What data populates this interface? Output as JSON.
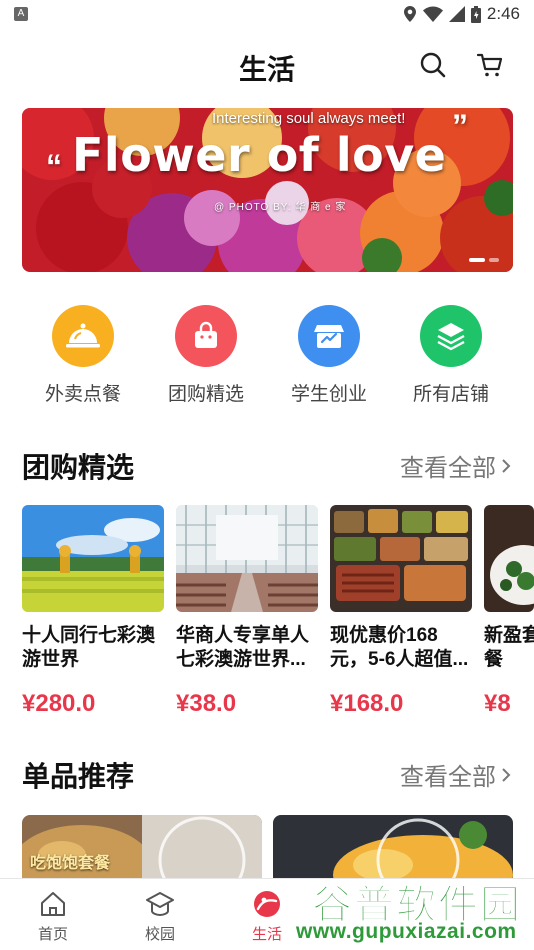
{
  "status_bar": {
    "time": "2:46",
    "notification_icon": "A"
  },
  "header": {
    "title": "生活",
    "search_icon": "search-icon",
    "cart_icon": "cart-icon"
  },
  "banner": {
    "headline": "Flower of love",
    "subtitle": "Interesting soul always meet!",
    "photo_credit": "@ PHOTO BY: 华 商 e 家",
    "quote_open": "“",
    "quote_close": "”",
    "page_count": 2,
    "active_page": 1
  },
  "categories": [
    {
      "label": "外卖点餐",
      "icon": "food-cloche-icon",
      "color": "#f9b020"
    },
    {
      "label": "团购精选",
      "icon": "shopping-bag-icon",
      "color": "#f4545b"
    },
    {
      "label": "学生创业",
      "icon": "storefront-icon",
      "color": "#3f8ff0"
    },
    {
      "label": "所有店铺",
      "icon": "layers-icon",
      "color": "#1fc46a"
    }
  ],
  "group_buy": {
    "title": "团购精选",
    "more": "查看全部",
    "items": [
      {
        "title": "十人同行七彩澳游世界",
        "price": "¥280.0"
      },
      {
        "title": "华商人专享单人七彩澳游世界...",
        "price": "¥38.0"
      },
      {
        "title": "现优惠价168元，5-6人超值...",
        "price": "¥168.0"
      },
      {
        "title": "新盈套餐",
        "price": "¥8"
      }
    ]
  },
  "single_recommend": {
    "title": "单品推荐",
    "more": "查看全部",
    "items": [
      {
        "tag": "吃饱饱套餐"
      },
      {
        "tag": ""
      }
    ]
  },
  "bottom_nav": {
    "items": [
      {
        "label": "首页",
        "icon": "home-icon",
        "active": false
      },
      {
        "label": "校园",
        "icon": "campus-icon",
        "active": false
      },
      {
        "label": "生活",
        "icon": "life-icon",
        "active": true
      }
    ]
  },
  "watermark": {
    "title": "谷普软件园",
    "url": "www.gupuxiazai.com"
  },
  "colors": {
    "accent": "#e8374a",
    "text_primary": "#111111",
    "text_secondary": "#777777"
  }
}
